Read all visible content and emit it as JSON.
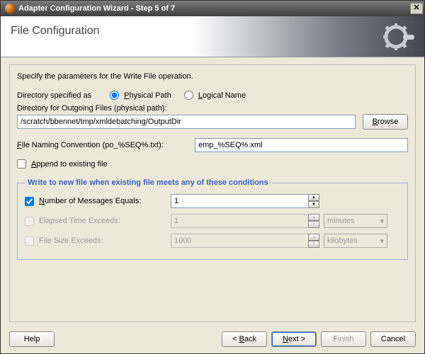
{
  "window": {
    "title": "Adapter Configuration Wizard - Step 5 of 7"
  },
  "header": {
    "title": "File Configuration"
  },
  "form": {
    "intro": "Specify the parameters for the Write File operation.",
    "dir_specified_as_label": "Directory specified as",
    "physical_path_label": "Physical Path",
    "logical_name_label": "Logical Name",
    "dir_path_type": "physical",
    "dir_label": "Directory for Outgoing Files (physical path):",
    "dir_value": "/scratch/bbennet/tmp/xmldebatching/OutputDir",
    "browse_label": "Browse",
    "naming_conv_label": "File Naming Convention (po_%SEQ%.txt):",
    "naming_conv_value": "emp_%SEQ%.xml",
    "append_label": "Append to existing file",
    "append_checked": false
  },
  "conditions": {
    "legend": "Write to new file when existing file meets any of these conditions",
    "num_messages": {
      "enabled": true,
      "label": "Number of Messages Equals:",
      "value": "1"
    },
    "elapsed_time": {
      "enabled": false,
      "label": "Elapsed Time Exceeds:",
      "value": "1",
      "unit": "minutes"
    },
    "file_size": {
      "enabled": false,
      "label": "File Size Exceeds:",
      "value": "1000",
      "unit": "kilobytes"
    }
  },
  "footer": {
    "help": "Help",
    "back": "< Back",
    "next": "Next >",
    "finish": "Finish",
    "cancel": "Cancel"
  }
}
